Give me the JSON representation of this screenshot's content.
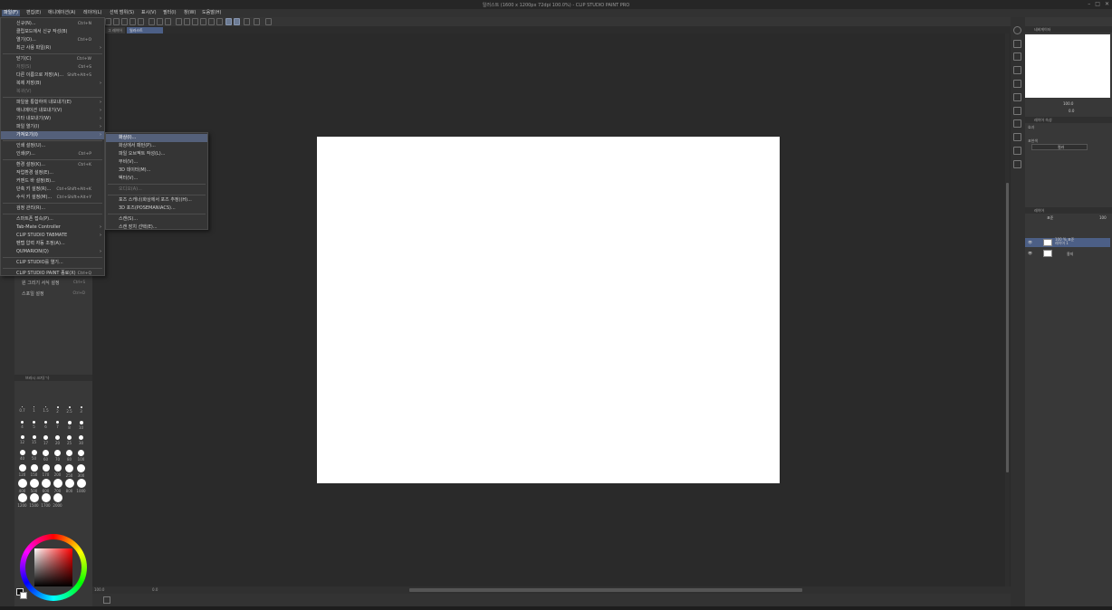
{
  "window": {
    "title": "일러스트 (1600 x 1200px 72dpi 100.0%)  - CLIP STUDIO PAINT PRO",
    "controls": [
      "–",
      "□",
      "✕"
    ]
  },
  "menubar": [
    "파일(F)",
    "편집(E)",
    "애니메이션(A)",
    "레이어(L)",
    "선택 범위(S)",
    "표시(V)",
    "필터(I)",
    "창(W)",
    "도움말(H)"
  ],
  "tabs": [
    "그 레이어",
    "일러스트"
  ],
  "file_menu": {
    "items": [
      {
        "label": "신규(N)...",
        "shortcut": "Ctrl+N"
      },
      {
        "label": "클립보드에서 신규 작성(B)",
        "shortcut": ""
      },
      {
        "label": "열기(O)...",
        "shortcut": "Ctrl+O"
      },
      {
        "label": "최근 사용 파일(R)",
        "shortcut": "",
        "submenu": true
      },
      {
        "label": "닫기(C)",
        "shortcut": "Ctrl+W"
      },
      {
        "label": "저장(S)",
        "shortcut": "Ctrl+S",
        "disabled": true
      },
      {
        "label": "다른 이름으로 저장(A)...",
        "shortcut": "Shift+Alt+S"
      },
      {
        "label": "복제 저장(B)",
        "shortcut": "",
        "submenu": true
      },
      {
        "label": "복귀(V)",
        "shortcut": "",
        "disabled": true
      },
      {
        "label": "파일을 통합하여 내보내기(E)",
        "shortcut": "",
        "submenu": true
      },
      {
        "label": "애니메이션 내보내기(V)",
        "shortcut": "",
        "submenu": true
      },
      {
        "label": "기타 내보내기(W)",
        "shortcut": "",
        "submenu": true
      },
      {
        "label": "파일 열기(I)",
        "shortcut": "",
        "submenu": true
      },
      {
        "label": "가져오기(I)",
        "shortcut": "",
        "submenu": true,
        "selected": true
      },
      {
        "label": "인쇄 설정(U)...",
        "shortcut": ""
      },
      {
        "label": "인쇄(P)...",
        "shortcut": "Ctrl+P"
      },
      {
        "label": "환경 설정(K)...",
        "shortcut": "Ctrl+K"
      },
      {
        "label": "작업환경 설정(E)...",
        "shortcut": ""
      },
      {
        "label": "커맨드 바 설정(B)...",
        "shortcut": ""
      },
      {
        "label": "단축 키 설정(R)...",
        "shortcut": "Ctrl+Shift+Alt+K"
      },
      {
        "label": "수식 키 설정(M)...",
        "shortcut": "Ctrl+Shift+Alt+Y"
      },
      {
        "label": "검정 관리(R)...",
        "shortcut": ""
      },
      {
        "label": "스마트폰 접속(P)...",
        "shortcut": ""
      },
      {
        "label": "Tab-Mate Controller",
        "shortcut": "",
        "submenu": true
      },
      {
        "label": "CLIP STUDIO TABMATE",
        "shortcut": "",
        "submenu": true
      },
      {
        "label": "펜탭 압력 자동 조정(A)...",
        "shortcut": ""
      },
      {
        "label": "QUMARION(Q)",
        "shortcut": "",
        "submenu": true
      },
      {
        "label": "CLIP STUDIO를 열기...",
        "shortcut": ""
      },
      {
        "label": "CLIP STUDIO PAINT 종료(X)",
        "shortcut": "Ctrl+Q"
      }
    ]
  },
  "import_submenu": {
    "items": [
      {
        "label": "화상(I)...",
        "selected": true
      },
      {
        "label": "화상에서 패턴(P)...",
        "disabled": false
      },
      {
        "label": "파일 오브젝트 작성(L)...",
        "disabled": false
      },
      {
        "label": "무비(V)...",
        "disabled": false
      },
      {
        "label": "3D 데이터(M)...",
        "disabled": false
      },
      {
        "label": "벡터(V)...",
        "disabled": false
      },
      {
        "label": "오디오(A)...",
        "disabled": true
      },
      {
        "label": "포즈 스캐너(화상에서 포즈 추정)(H)...",
        "disabled": false
      },
      {
        "label": "3D 포즈(POSEMANIACS)...",
        "disabled": false
      },
      {
        "label": "스캔(S)...",
        "disabled": false
      },
      {
        "label": "스캔 장치 선택(E)...",
        "disabled": false
      }
    ]
  },
  "left_panel": {
    "rows": [
      {
        "label": "원 그리기 서식 설정",
        "key": "Ctrl+S"
      },
      {
        "label": "스포일 설정",
        "key": "Ctrl+D"
      }
    ],
    "brush_size_header": "브러시 크기(ㄱ)",
    "brush_sizes": [
      "0.7",
      "1",
      "1.5",
      "2",
      "2.5",
      "3",
      "4",
      "5",
      "6",
      "7",
      "8",
      "10",
      "12",
      "15",
      "17",
      "20",
      "25",
      "30",
      "40",
      "50",
      "60",
      "70",
      "80",
      "100",
      "120",
      "150",
      "170",
      "200",
      "250",
      "300",
      "400",
      "500",
      "600",
      "700",
      "800",
      "1000",
      "1200",
      "1500",
      "1700",
      "2000"
    ]
  },
  "right_panel": {
    "navigator_header": "네비게이터",
    "zoom": "100.0",
    "angle": "0.0",
    "sub_header": "레이어 속성",
    "effect_label": "효과",
    "color_label": "표현색",
    "color_value": "컬러",
    "layer_header": "레이어",
    "blend": "표준",
    "opacity": "100",
    "layers": [
      {
        "name": "100 % 표준\n레이어 1",
        "selected": true
      },
      {
        "name": "용지",
        "selected": false
      }
    ]
  },
  "canvas": {
    "zoom_readout": "100.0",
    "angle_readout": "0.0"
  }
}
